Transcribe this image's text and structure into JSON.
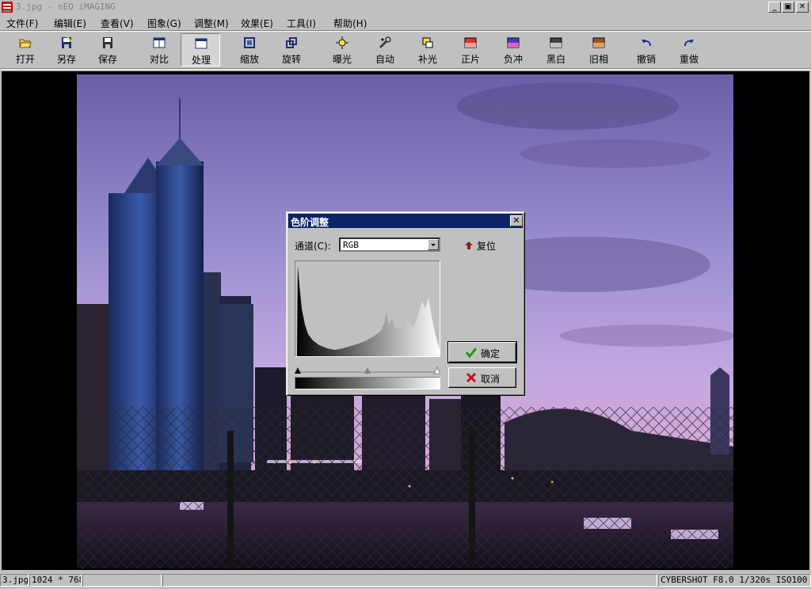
{
  "window": {
    "title": "3.jpg - nEO iMAGING",
    "controls": {
      "minimize": "_",
      "restore": "▣",
      "close": "✕"
    }
  },
  "menu": [
    {
      "label": "文件(F)"
    },
    {
      "label": "编辑(E)"
    },
    {
      "label": "查看(V)"
    },
    {
      "label": "图象(G)"
    },
    {
      "label": "调整(M)"
    },
    {
      "label": "效果(E)"
    },
    {
      "label": "工具(I)"
    },
    {
      "label": "帮助(H)"
    }
  ],
  "toolbar": [
    {
      "label": "打开",
      "icon": "open-folder-icon"
    },
    {
      "label": "另存",
      "icon": "save-as-icon"
    },
    {
      "label": "保存",
      "icon": "save-icon"
    },
    {
      "label": "对比",
      "icon": "compare-icon"
    },
    {
      "label": "处理",
      "icon": "process-icon",
      "active": true
    },
    {
      "label": "缩放",
      "icon": "zoom-icon"
    },
    {
      "label": "旋转",
      "icon": "rotate-icon"
    },
    {
      "label": "曝光",
      "icon": "exposure-icon"
    },
    {
      "label": "自动",
      "icon": "auto-icon"
    },
    {
      "label": "补光",
      "icon": "fill-light-icon"
    },
    {
      "label": "正片",
      "icon": "positive-icon"
    },
    {
      "label": "负冲",
      "icon": "cross-process-icon"
    },
    {
      "label": "黑白",
      "icon": "black-white-icon"
    },
    {
      "label": "旧相",
      "icon": "sepia-icon"
    },
    {
      "label": "撤销",
      "icon": "undo-icon"
    },
    {
      "label": "重做",
      "icon": "redo-icon"
    }
  ],
  "dialog": {
    "title": "色阶调整",
    "channel_label": "通道(C):",
    "channel_value": "RGB",
    "reset_label": "复位",
    "ok_label": "确定",
    "cancel_label": "取消",
    "close": "✕"
  },
  "status": {
    "filename": "3.jpg",
    "dimensions": "1024 * 768",
    "exif": "CYBERSHOT F8.0 1/320s ISO100"
  },
  "colors": {
    "title_active": "#0a246a",
    "ok_check": "#1a9a1a",
    "cancel_x": "#cc1111",
    "reset_arrow": "#a01818"
  }
}
